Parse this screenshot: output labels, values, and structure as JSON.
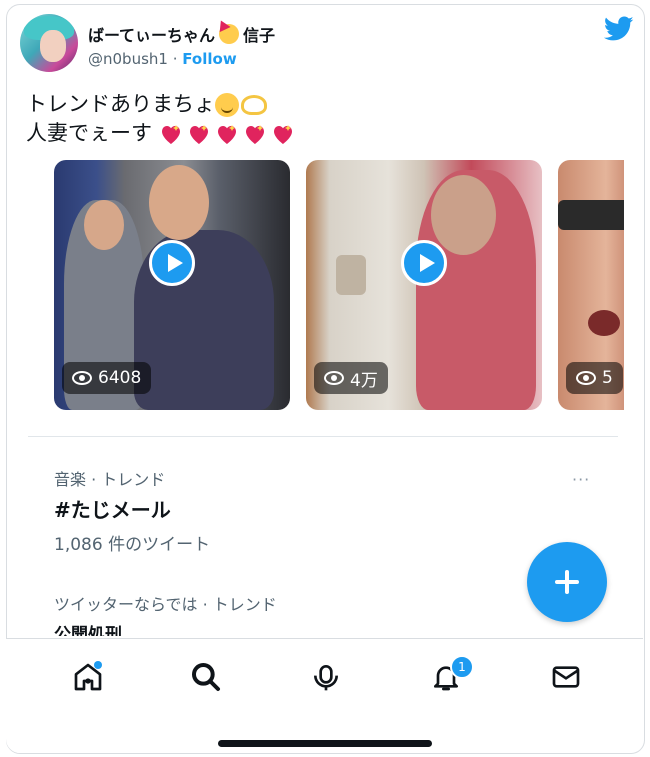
{
  "tweet": {
    "display_name": "ばーてぃーちゃん",
    "name_suffix": "信子",
    "handle": "@n0bush1",
    "separator": "·",
    "follow_label": "Follow",
    "text_line1": "トレンドありまちょ",
    "text_line2": "人妻でぇーす",
    "heart_count": 5
  },
  "media": [
    {
      "views": "6408",
      "icon": "play-icon"
    },
    {
      "views": "4万",
      "icon": "play-icon"
    },
    {
      "views": "5",
      "icon": "play-icon"
    }
  ],
  "trends": [
    {
      "meta": "音楽 · トレンド",
      "title": "#たじメール",
      "count": "1,086 件のツイート",
      "more": "···"
    },
    {
      "meta": "ツイッターならでは · トレンド",
      "title": "公開処刑"
    }
  ],
  "nav": {
    "items": [
      "home-icon",
      "search-icon",
      "spaces-icon",
      "notifications-icon",
      "messages-icon"
    ],
    "notification_badge": "1"
  },
  "colors": {
    "accent": "#1d9bf0",
    "heart": "#e0245e",
    "text": "#0f1419",
    "muted": "#536471"
  }
}
